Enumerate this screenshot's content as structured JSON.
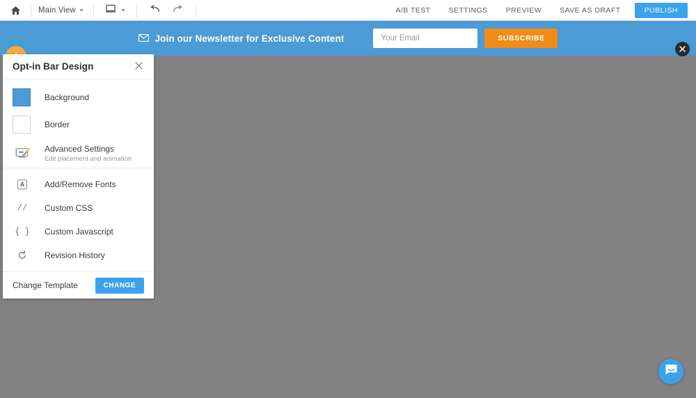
{
  "toolbar": {
    "home_icon": "home-icon",
    "view_label": "Main View",
    "device_icon": "laptop-icon",
    "undo_icon": "undo-icon",
    "redo_icon": "redo-icon",
    "actions": [
      {
        "label": "A/B TEST",
        "name": "ab-test"
      },
      {
        "label": "SETTINGS",
        "name": "settings"
      },
      {
        "label": "PREVIEW",
        "name": "preview"
      },
      {
        "label": "SAVE AS DRAFT",
        "name": "save-as-draft"
      }
    ],
    "publish_label": "PUBLISH",
    "publish_color": "#3BA3EC"
  },
  "optin_bar": {
    "background_color": "#4A9BD6",
    "headline": "Join our Newsletter for Exclusive Content",
    "mail_icon": "envelope-icon",
    "email_placeholder": "Your Email",
    "email_value": "",
    "subscribe_label": "SUBSCRIBE",
    "subscribe_color": "#F08B16",
    "add_button_icon": "plus-icon",
    "add_button_color": "#F5A93C",
    "close_button_icon": "close-icon"
  },
  "panel": {
    "title": "Opt-in Bar Design",
    "close_icon": "close-icon",
    "swatches": [
      {
        "label": "Background",
        "color": "#4A9BD6",
        "name": "background"
      },
      {
        "label": "Border",
        "color": "#FFFFFF",
        "name": "border"
      }
    ],
    "advanced": {
      "title": "Advanced Settings",
      "subtitle": "Edit placement and animation",
      "icon": "magic-wand-screen-icon"
    },
    "items": [
      {
        "label": "Add/Remove Fonts",
        "icon": "font-a-icon",
        "glyph": "A",
        "name": "add-remove-fonts"
      },
      {
        "label": "Custom CSS",
        "icon": "slashes-icon",
        "glyph": "//",
        "name": "custom-css"
      },
      {
        "label": "Custom Javascript",
        "icon": "braces-icon",
        "glyph": "{ }",
        "name": "custom-javascript"
      },
      {
        "label": "Revision History",
        "icon": "refresh-icon",
        "glyph": "",
        "name": "revision-history"
      }
    ],
    "footer": {
      "label": "Change Template",
      "button_label": "CHANGE",
      "button_color": "#3BA3EC"
    }
  },
  "canvas": {
    "background_color": "#828282"
  },
  "chat": {
    "icon": "chat-bubble-icon",
    "color": "#3BA3EC"
  }
}
